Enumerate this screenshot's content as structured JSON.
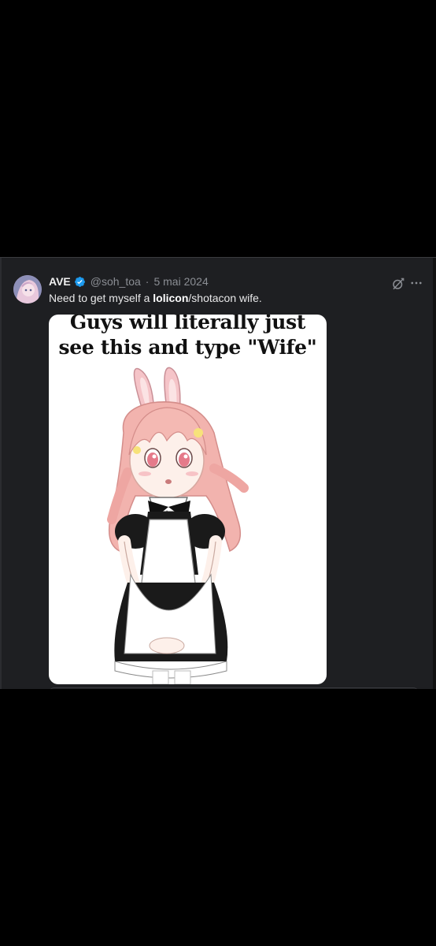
{
  "tweet": {
    "display_name": "AVE",
    "handle": "@soh_toa",
    "date": "5 mai 2024",
    "text_before": "Need to get myself a ",
    "text_bold": "lolicon",
    "text_after": "/shotacon wife.",
    "icons": {
      "verified": "verified-badge-icon",
      "grok": "grok-icon",
      "more": "more-options-icon"
    }
  },
  "media": {
    "caption_line1": "Guys will literally just",
    "caption_line2": "see this and type \"Wife\"",
    "image_subject": "maid-bunny-girl-illustration"
  },
  "colors": {
    "card_bg": "#1e1f22",
    "verified": "#1d9bf0",
    "meta_text": "#8b8e94"
  }
}
